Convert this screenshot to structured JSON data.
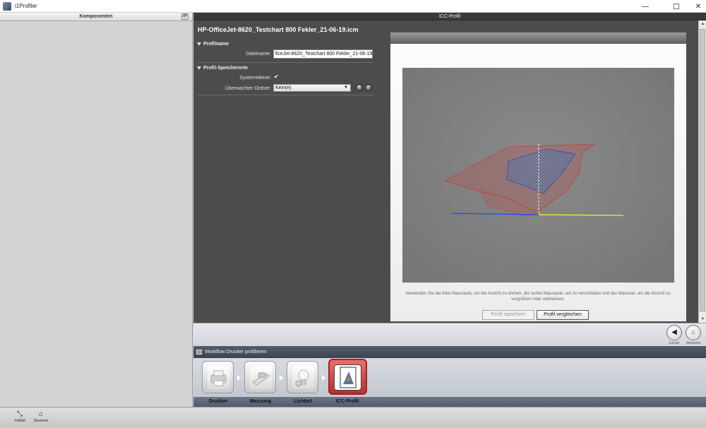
{
  "window": {
    "title": "i1Profiler",
    "controls": {
      "minimize": "—",
      "maximize": "☐",
      "close": "✕"
    }
  },
  "left_panel": {
    "title": "Komponenten",
    "refresh_glyph": "⟳"
  },
  "icc_panel": {
    "title": "ICC-Profil",
    "filename": "HP-OfficeJet-8620_Testchart 800 Fekler_21-06-19.icm",
    "profilname": {
      "section_label": "Profilname",
      "dateiname_label": "Dateiname:",
      "dateiname_value": "ficeJet-8620_Testchart 800 Fekler_21-06-19.icm"
    },
    "speicherorte": {
      "section_label": "Profil-Speicherorte",
      "systemebene_label": "Systemebene:",
      "systemebene_checked": true,
      "ordner_label": "Überwachter Ordner:",
      "ordner_value": "Kein(e)",
      "add_glyph": "+",
      "remove_glyph": "−"
    }
  },
  "viewer": {
    "hint": "Verwenden Sie die linke Maustaste, um die Ansicht zu drehen, die rechte Maustaste, um zu verschieben und das Mausrad, um die Ansicht zu vergrößern oder verkleinern.",
    "save_label": "Profil speichern",
    "compare_label": "Profil vergleichen",
    "gamut_colors": {
      "printer": "#c2403a",
      "reference": "#2e3fb0",
      "axis_b": "#2244ff",
      "axis_y": "#ffee33",
      "axis_g": "#33cc33"
    }
  },
  "nav": {
    "back_label": "Zurück",
    "back_glyph": "◀",
    "home_label": "Startseite",
    "home_glyph": "⌂"
  },
  "workflow": {
    "title": "Workflow Drucker profilieren",
    "steps": [
      {
        "label": "Drucker",
        "icon": "printer-icon",
        "active": false
      },
      {
        "label": "Messung",
        "icon": "measurement-icon",
        "active": false
      },
      {
        "label": "Lichtart",
        "icon": "lightbulb-icon",
        "active": false
      },
      {
        "label": "ICC-Profil",
        "icon": "icc-profile-icon",
        "active": true
      }
    ]
  },
  "bottom_bar": {
    "vollbild_label": "Vollbild",
    "vollbild_glyph": "⤡",
    "startseite_label": "Startseite",
    "startseite_glyph": "⌂"
  }
}
